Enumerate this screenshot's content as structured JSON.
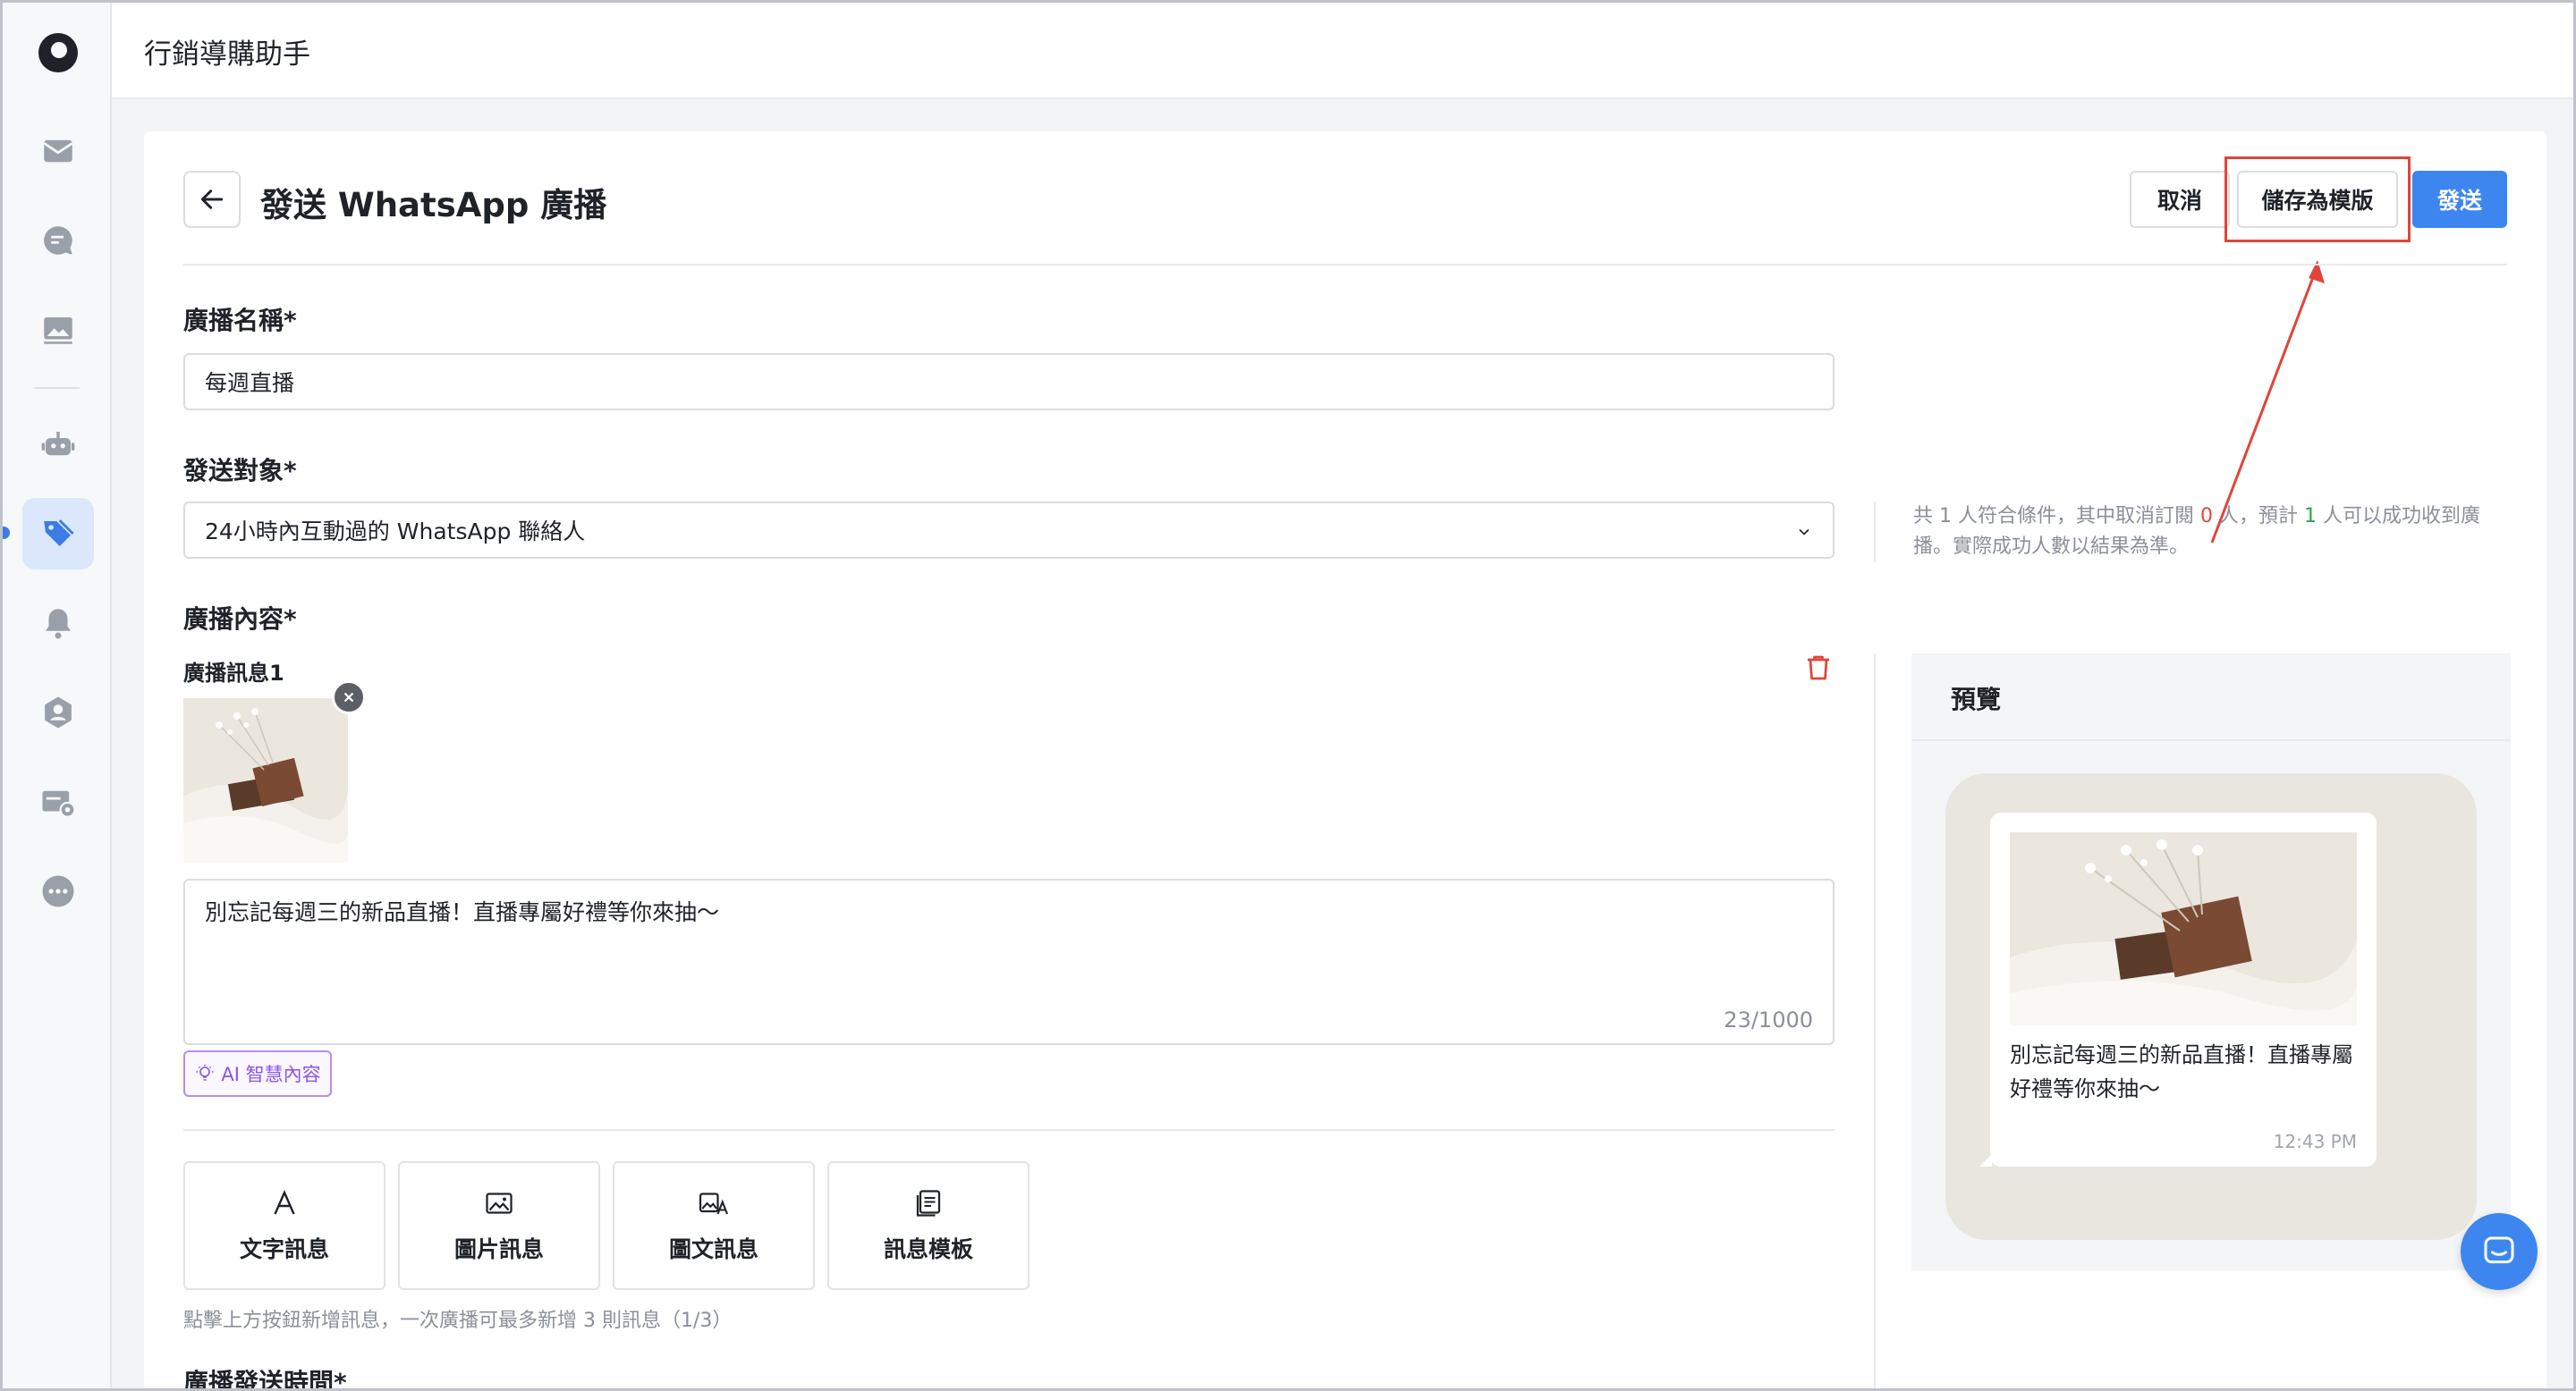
{
  "app": {
    "title": "行銷導購助手"
  },
  "page": {
    "title": "發送 WhatsApp 廣播"
  },
  "actions": {
    "cancel": "取消",
    "save_template": "儲存為模版",
    "send": "發送"
  },
  "sidebar": {
    "items": [
      {
        "icon": "inbox-icon"
      },
      {
        "icon": "chat-icon"
      },
      {
        "icon": "image-icon"
      },
      {
        "icon": "bot-icon"
      },
      {
        "icon": "tag-icon",
        "active": true
      },
      {
        "icon": "bell-icon"
      },
      {
        "icon": "contact-icon"
      },
      {
        "icon": "card-settings-icon"
      },
      {
        "icon": "more-icon"
      }
    ]
  },
  "form": {
    "broadcast_name": {
      "label": "廣播名稱*",
      "value": "每週直播"
    },
    "audience": {
      "label": "發送對象*",
      "value": "24小時內互動過的 WhatsApp 聯絡人",
      "note": {
        "prefix": "共 1 人符合條件，其中取消訂閱 ",
        "unsub_count": "0",
        "middle": " 人，預計 ",
        "success_count": "1",
        "suffix": " 人可以成功收到廣播。實際成功人數以結果為準。"
      }
    },
    "content": {
      "label": "廣播內容*",
      "message_label": "廣播訊息1",
      "text": "別忘記每週三的新品直播！直播專屬好禮等你來抽～",
      "counter": "23/1000",
      "ai_button": "AI 智慧內容"
    },
    "message_types": [
      {
        "label": "文字訊息",
        "icon": "text-icon"
      },
      {
        "label": "圖片訊息",
        "icon": "image-icon"
      },
      {
        "label": "圖文訊息",
        "icon": "image-text-icon"
      },
      {
        "label": "訊息模板",
        "icon": "template-icon"
      }
    ],
    "hint": "點擊上方按鈕新增訊息，一次廣播可最多新增 3 則訊息（1/3）",
    "schedule_label": "廣播發送時間*"
  },
  "preview": {
    "title": "預覽",
    "text": "別忘記每週三的新品直播！直播專屬好禮等你來抽～",
    "time": "12:43 PM"
  },
  "colors": {
    "primary": "#3d86f0",
    "highlight": "#e0453a",
    "ai": "#8a55e6"
  }
}
